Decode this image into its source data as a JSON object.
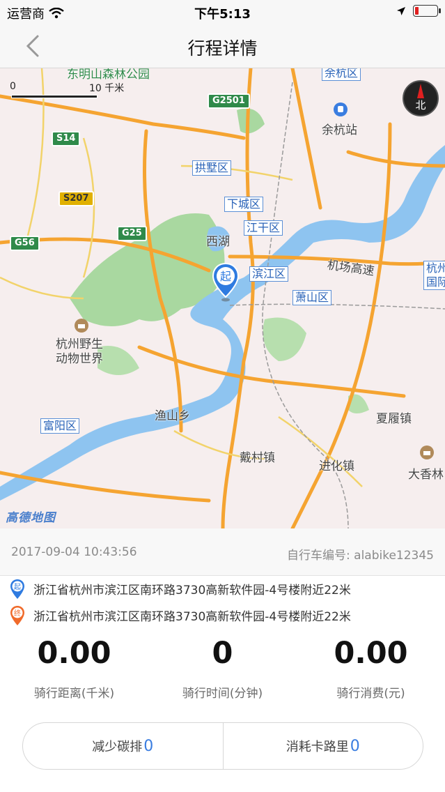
{
  "status_bar": {
    "carrier": "运营商",
    "time": "下午5:13",
    "battery_level": 0.15
  },
  "nav": {
    "title": "行程详情",
    "back_icon": "chevron-left-icon"
  },
  "map": {
    "scale": {
      "zero": "0",
      "ten": "10 千米"
    },
    "compass_label": "北",
    "start_marker_label": "起",
    "logo": "高德地图",
    "districts": [
      "余杭区",
      "拱墅区",
      "下城区",
      "江干区",
      "滨江区",
      "萧山区",
      "富阳区",
      "杭州国际"
    ],
    "roads": [
      "G2501",
      "S14",
      "S207",
      "G25",
      "G56"
    ],
    "places": [
      "东明山森林公园",
      "余杭站",
      "西湖",
      "机场高速",
      "杭州野生动物世界",
      "渔山乡",
      "戴村镇",
      "进化镇",
      "夏履镇",
      "大香林"
    ]
  },
  "trip": {
    "datetime": "2017-09-04 10:43:56",
    "bike_label": "自行车编号: alabike12345",
    "start_badge": "起",
    "end_badge": "终",
    "start_address": "浙江省杭州市滨江区南环路3730高新软件园-4号楼附近22米",
    "end_address": "浙江省杭州市滨江区南环路3730高新软件园-4号楼附近22米"
  },
  "stats": {
    "distance_value": "0.00",
    "distance_label": "骑行距离(千米)",
    "time_value": "0",
    "time_label": "骑行时间(分钟)",
    "cost_value": "0.00",
    "cost_label": "骑行消费(元)"
  },
  "eco": {
    "carbon_label": "减少碳排",
    "carbon_value": "0",
    "calorie_label": "消耗卡路里",
    "calorie_value": "0"
  },
  "colors": {
    "accent_blue": "#3a7de0",
    "start_pin": "#2f7be0",
    "end_pin": "#f06a2a",
    "river": "#8ec4f0",
    "park": "#a9d8a0",
    "road": "#f5a431"
  }
}
